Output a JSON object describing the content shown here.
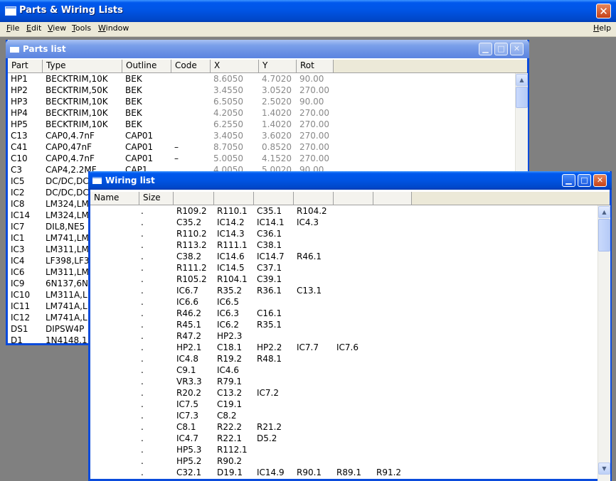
{
  "app": {
    "title": "Parts & Wiring Lists",
    "close_glyph": "✕"
  },
  "menu": {
    "left": [
      {
        "u": "F",
        "rest": "ile"
      },
      {
        "u": "E",
        "rest": "dit"
      },
      {
        "u": "V",
        "rest": "iew"
      },
      {
        "u": "T",
        "rest": "ools"
      },
      {
        "u": "W",
        "rest": "indow"
      }
    ],
    "help": {
      "u": "H",
      "rest": "elp"
    }
  },
  "parts": {
    "title": "Parts list",
    "columns": [
      "Part",
      "Type",
      "Outline",
      "Code",
      "X",
      "Y",
      "Rot"
    ],
    "rows": [
      [
        "HP1",
        "BECKTRIM,10K",
        "BEK",
        "",
        "8.6050",
        "4.7020",
        "90.00"
      ],
      [
        "HP2",
        "BECKTRIM,50K",
        "BEK",
        "",
        "3.4550",
        "3.0520",
        "270.00"
      ],
      [
        "HP3",
        "BECKTRIM,10K",
        "BEK",
        "",
        "6.5050",
        "2.5020",
        "90.00"
      ],
      [
        "HP4",
        "BECKTRIM,10K",
        "BEK",
        "",
        "4.2050",
        "1.4020",
        "270.00"
      ],
      [
        "HP5",
        "BECKTRIM,10K",
        "BEK",
        "",
        "6.2550",
        "1.4020",
        "270.00"
      ],
      [
        "C13",
        "CAP0,4.7nF",
        "CAP01",
        "",
        "3.4050",
        "3.6020",
        "270.00"
      ],
      [
        "C41",
        "CAP0,47nF",
        "CAP01",
        "–",
        "8.7050",
        "0.8520",
        "270.00"
      ],
      [
        "C10",
        "CAP0,4.7nF",
        "CAP01",
        "–",
        "5.0050",
        "4.1520",
        "270.00"
      ],
      [
        "C3",
        "CAP4,2.2MF",
        "CAP1",
        "",
        "4.0050",
        "5.0020",
        "90.00"
      ],
      [
        "IC5",
        "DC/DC,DC",
        "",
        "",
        "",
        "",
        ""
      ],
      [
        "IC2",
        "DC/DC,DC",
        "",
        "",
        "",
        "",
        ""
      ],
      [
        "IC8",
        "LM324,LM",
        "",
        "",
        "",
        "",
        ""
      ],
      [
        "IC14",
        "LM324,LM",
        "",
        "",
        "",
        "",
        ""
      ],
      [
        "IC7",
        "DIL8,NE5",
        "",
        "",
        "",
        "",
        ""
      ],
      [
        "IC1",
        "LM741,LM",
        "",
        "",
        "",
        "",
        ""
      ],
      [
        "IC3",
        "LM311,LM",
        "",
        "",
        "",
        "",
        ""
      ],
      [
        "IC4",
        "LF398,LF3",
        "",
        "",
        "",
        "",
        ""
      ],
      [
        "IC6",
        "LM311,LM",
        "",
        "",
        "",
        "",
        ""
      ],
      [
        "IC9",
        "6N137,6N",
        "",
        "",
        "",
        "",
        ""
      ],
      [
        "IC10",
        "LM311A,L",
        "",
        "",
        "",
        "",
        ""
      ],
      [
        "IC11",
        "LM741A,L",
        "",
        "",
        "",
        "",
        ""
      ],
      [
        "IC12",
        "LM741A,L",
        "",
        "",
        "",
        "",
        ""
      ],
      [
        "DS1",
        "DIPSW4P",
        "",
        "",
        "",
        "",
        ""
      ],
      [
        "D1",
        "1N4148,1",
        "",
        "",
        "",
        "",
        ""
      ]
    ]
  },
  "wiring": {
    "title": "Wiring list",
    "columns": [
      "Name",
      "Size",
      "",
      "",
      "",
      "",
      "",
      ""
    ],
    "rows": [
      [
        "",
        ".",
        "R109.2",
        "R110.1",
        "C35.1",
        "R104.2",
        "",
        ""
      ],
      [
        "",
        ".",
        "C35.2",
        "IC14.2",
        "IC14.1",
        "IC4.3",
        "",
        ""
      ],
      [
        "",
        ".",
        "R110.2",
        "IC14.3",
        "C36.1",
        "",
        "",
        ""
      ],
      [
        "",
        ".",
        "R113.2",
        "R111.1",
        "C38.1",
        "",
        "",
        ""
      ],
      [
        "",
        ".",
        "C38.2",
        "IC14.6",
        "IC14.7",
        "R46.1",
        "",
        ""
      ],
      [
        "",
        ".",
        "R111.2",
        "IC14.5",
        "C37.1",
        "",
        "",
        ""
      ],
      [
        "",
        ".",
        "R105.2",
        "R104.1",
        "C39.1",
        "",
        "",
        ""
      ],
      [
        "",
        ".",
        "IC6.7",
        "R35.2",
        "R36.1",
        "C13.1",
        "",
        ""
      ],
      [
        "",
        ".",
        "IC6.6",
        "IC6.5",
        "",
        "",
        "",
        ""
      ],
      [
        "",
        ".",
        "R46.2",
        "IC6.3",
        "C16.1",
        "",
        "",
        ""
      ],
      [
        "",
        ".",
        "R45.1",
        "IC6.2",
        "R35.1",
        "",
        "",
        ""
      ],
      [
        "",
        ".",
        "R47.2",
        "HP2.3",
        "",
        "",
        "",
        ""
      ],
      [
        "",
        ".",
        "HP2.1",
        "C18.1",
        "HP2.2",
        "IC7.7",
        "IC7.6",
        ""
      ],
      [
        "",
        ".",
        "IC4.8",
        "R19.2",
        "R48.1",
        "",
        "",
        ""
      ],
      [
        "",
        ".",
        "C9.1",
        "IC4.6",
        "",
        "",
        "",
        ""
      ],
      [
        "",
        ".",
        "VR3.3",
        "R79.1",
        "",
        "",
        "",
        ""
      ],
      [
        "",
        ".",
        "R20.2",
        "C13.2",
        "IC7.2",
        "",
        "",
        ""
      ],
      [
        "",
        ".",
        "IC7.5",
        "C19.1",
        "",
        "",
        "",
        ""
      ],
      [
        "",
        ".",
        "IC7.3",
        "C8.2",
        "",
        "",
        "",
        ""
      ],
      [
        "",
        ".",
        "C8.1",
        "R22.2",
        "R21.2",
        "",
        "",
        ""
      ],
      [
        "",
        ".",
        "IC4.7",
        "R22.1",
        "D5.2",
        "",
        "",
        ""
      ],
      [
        "",
        ".",
        "HP5.3",
        "R112.1",
        "",
        "",
        "",
        ""
      ],
      [
        "",
        ".",
        "HP5.2",
        "R90.2",
        "",
        "",
        "",
        ""
      ],
      [
        "",
        ".",
        "C32.1",
        "D19.1",
        "IC14.9",
        "R90.1",
        "R89.1",
        "R91.2"
      ]
    ]
  },
  "icons": {
    "minimize": "minimize-icon",
    "maximize": "maximize-icon",
    "close": "close-icon",
    "scroll_up": "▲",
    "scroll_down": "▼",
    "min_glyph": "▁",
    "max_glyph": "□",
    "close_glyph": "✕"
  },
  "colors": {
    "title_active": "#0054e3",
    "title_inactive": "#7a9ee8",
    "mdi_bg": "#808080",
    "coord_gray": "#888888"
  }
}
